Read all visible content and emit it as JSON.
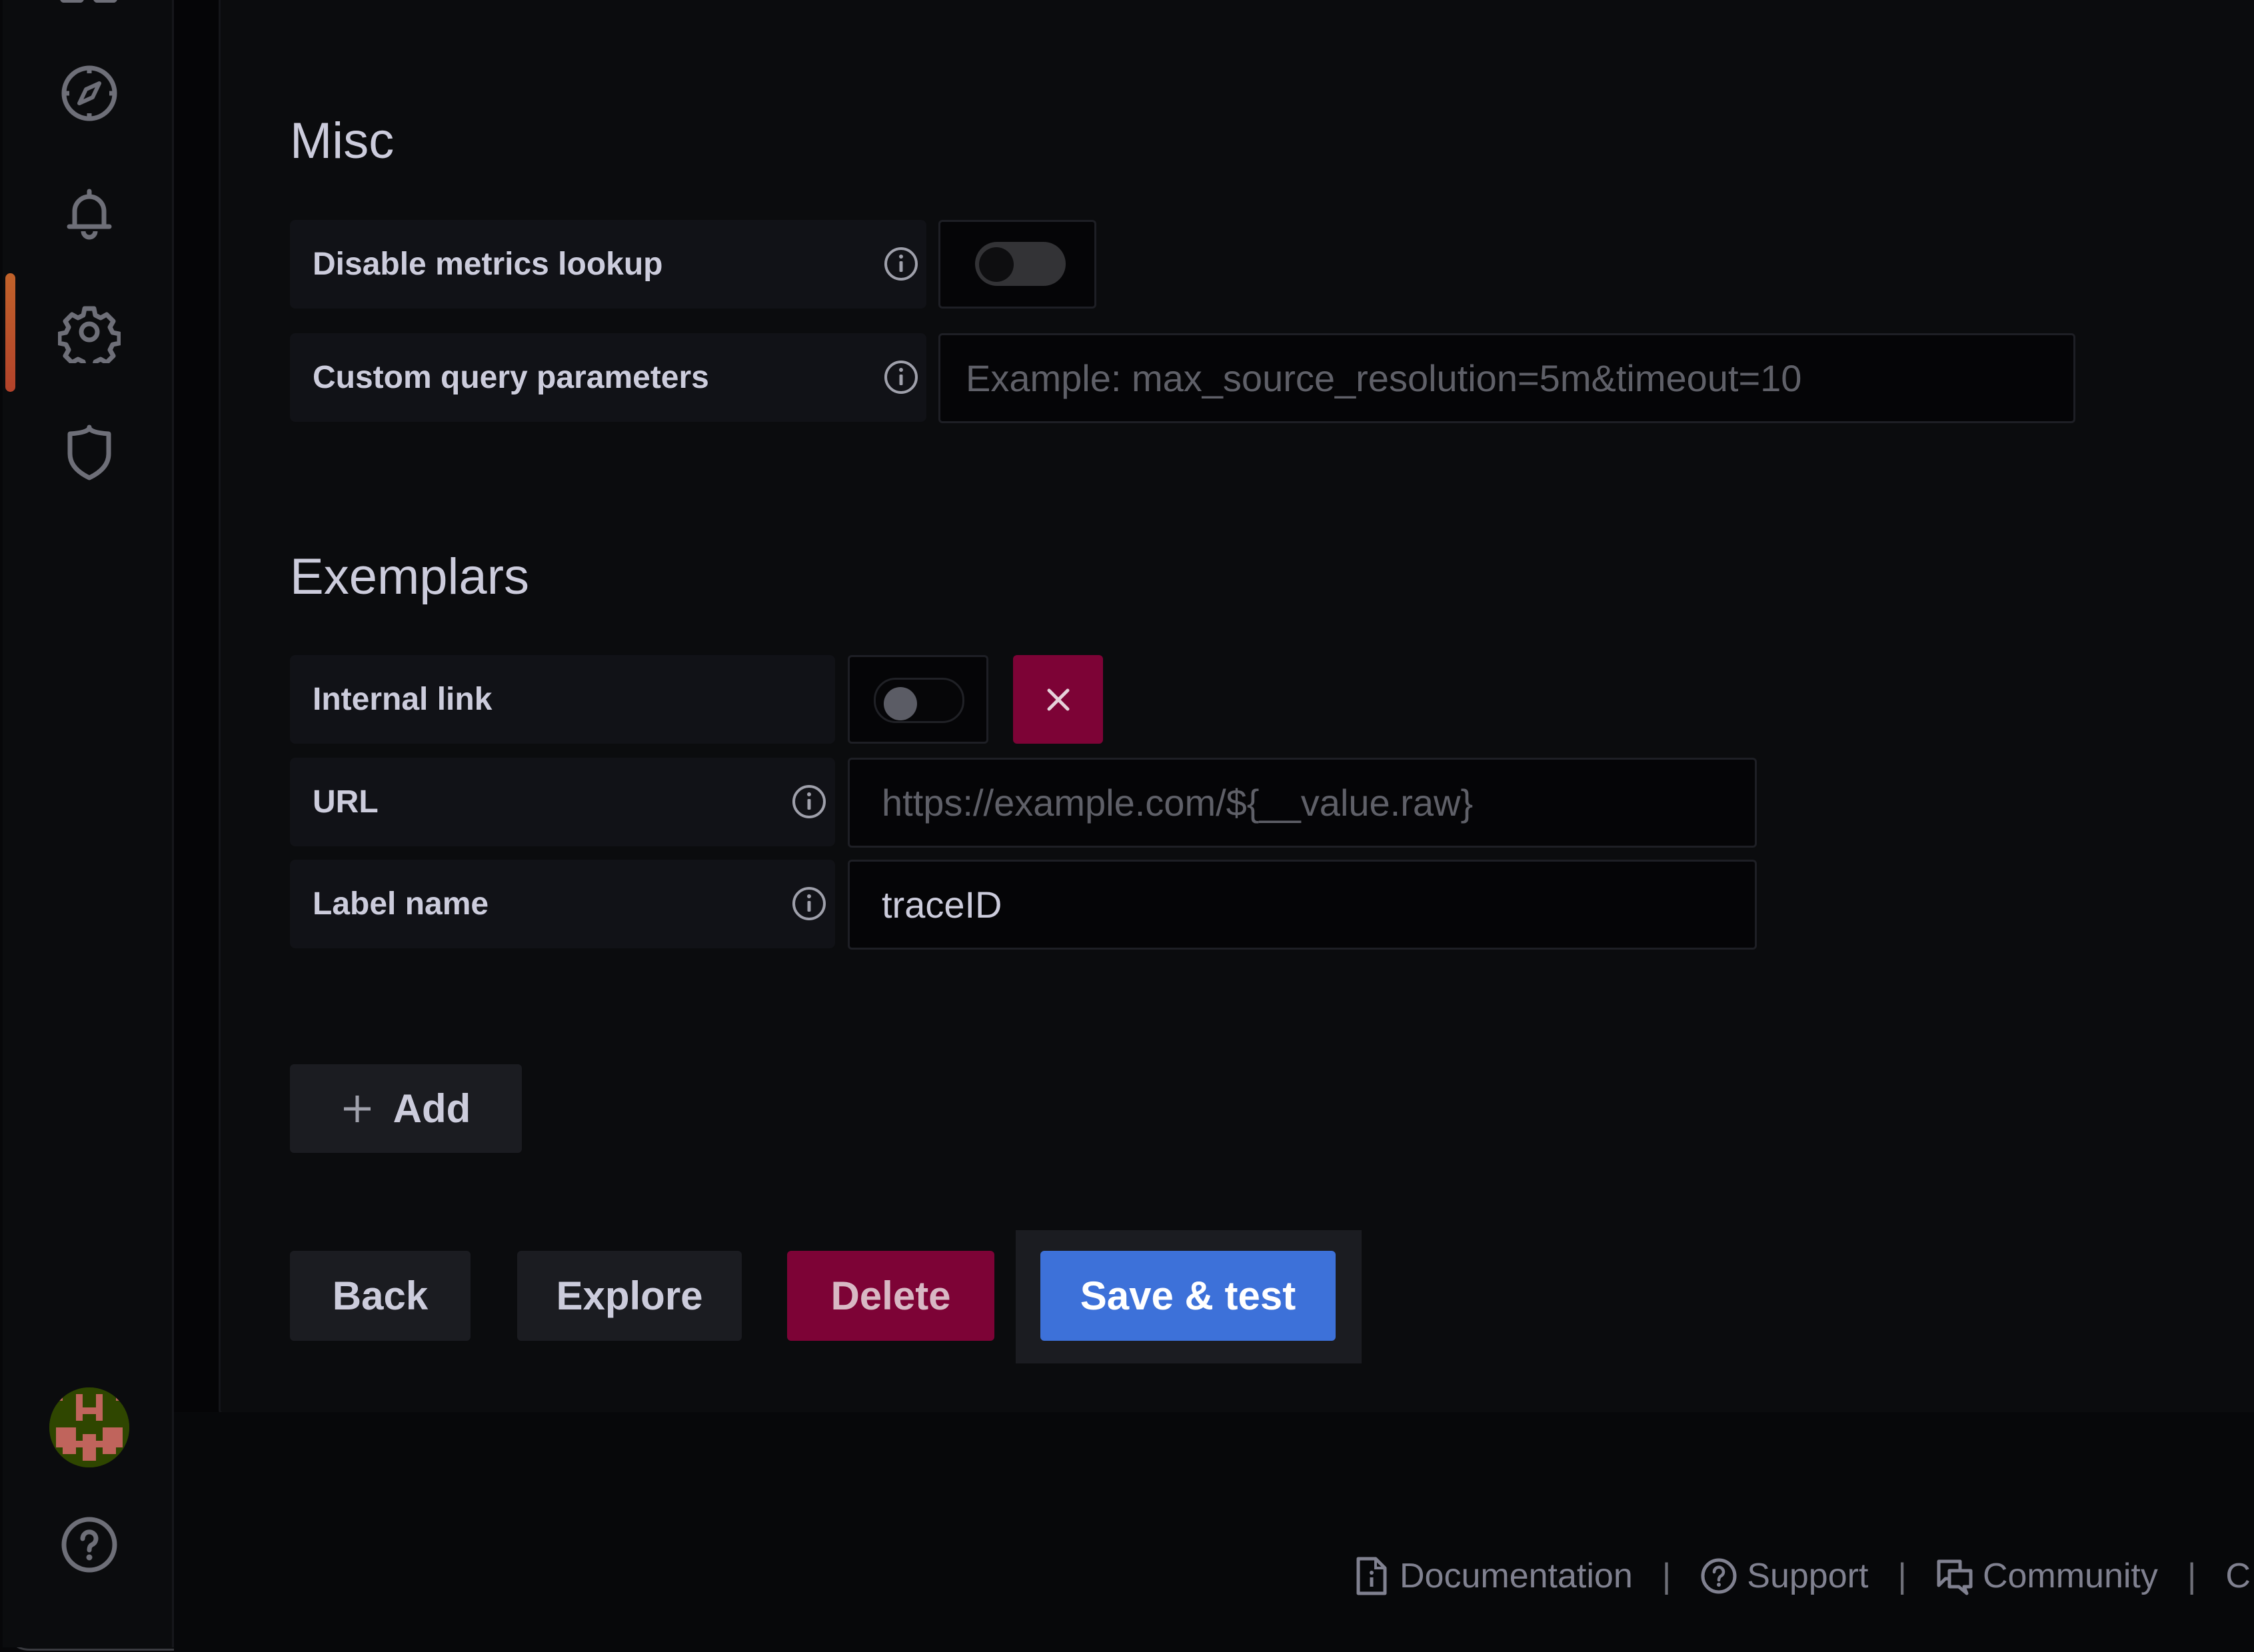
{
  "sidebar": {
    "items": [
      {
        "name": "explore",
        "icon": "compass-icon"
      },
      {
        "name": "alerting",
        "icon": "bell-icon"
      },
      {
        "name": "configuration",
        "icon": "gear-icon",
        "active": true
      },
      {
        "name": "server-admin",
        "icon": "shield-icon"
      }
    ],
    "bottom": [
      {
        "name": "profile",
        "icon": "avatar"
      },
      {
        "name": "help",
        "icon": "question-circle-icon"
      }
    ],
    "active_indicator_color": "#c1622a"
  },
  "misc": {
    "title": "Misc",
    "disable_metrics_lookup": {
      "label": "Disable metrics lookup",
      "enabled": false
    },
    "custom_query_parameters": {
      "label": "Custom query parameters",
      "value": "",
      "placeholder": "Example: max_source_resolution=5m&timeout=10"
    }
  },
  "exemplars": {
    "title": "Exemplars",
    "internal_link": {
      "label": "Internal link",
      "enabled": false
    },
    "url": {
      "label": "URL",
      "value": "",
      "placeholder": "https://example.com/${__value.raw}"
    },
    "label_name": {
      "label": "Label name",
      "value": "traceID",
      "placeholder": ""
    },
    "add_label": "Add"
  },
  "actions": {
    "back": "Back",
    "explore": "Explore",
    "delete": "Delete",
    "save_test": "Save & test"
  },
  "footer": {
    "links": [
      {
        "label": "Documentation",
        "icon": "document-info-icon"
      },
      {
        "label": "Support",
        "icon": "question-circle-icon"
      },
      {
        "label": "Community",
        "icon": "comments-icon"
      }
    ],
    "separator": "|"
  },
  "colors": {
    "primary": "#3d71d9",
    "danger": "#7d0336",
    "background": "#0b0c0e"
  }
}
